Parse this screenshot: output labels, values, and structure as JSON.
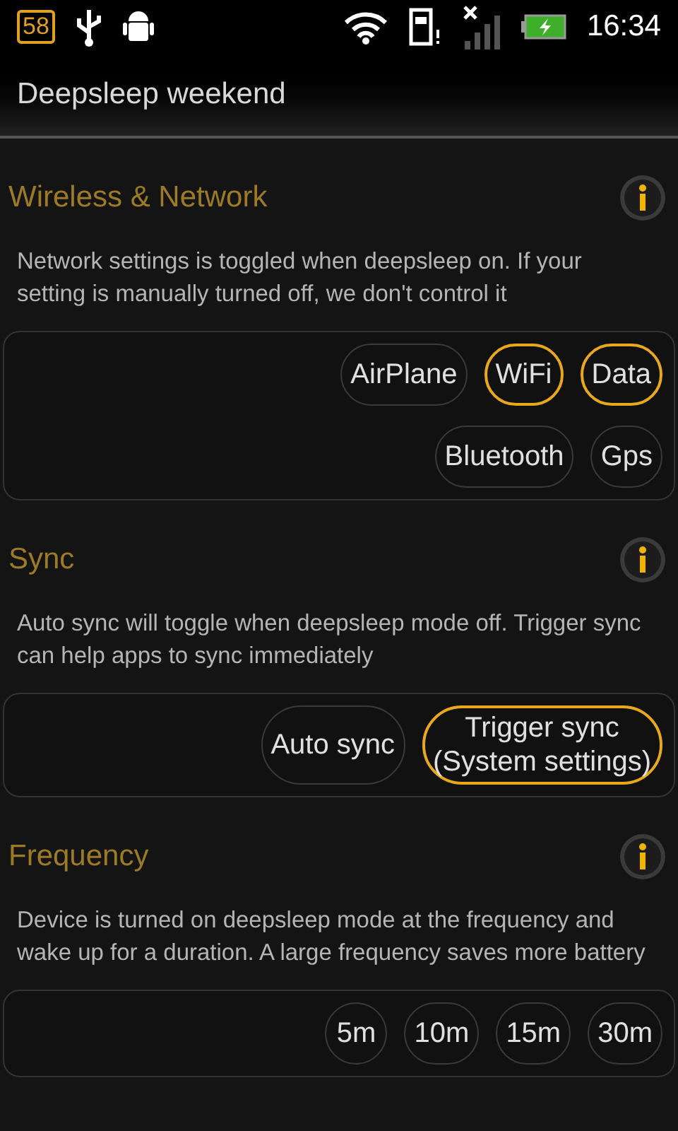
{
  "status_bar": {
    "notification_badge": "58",
    "time": "16:34"
  },
  "title": "Deepsleep weekend",
  "sections": [
    {
      "title": "Wireless & Network",
      "description": "Network settings is toggled when deepsleep on. If your setting is manually turned off, we don't control it",
      "options": [
        {
          "label": "AirPlane",
          "selected": false
        },
        {
          "label": "WiFi",
          "selected": true
        },
        {
          "label": "Data",
          "selected": true
        },
        {
          "label": "Bluetooth",
          "selected": false
        },
        {
          "label": "Gps",
          "selected": false
        }
      ]
    },
    {
      "title": "Sync",
      "description": "Auto sync will toggle when deepsleep mode off. Trigger sync can help apps to sync immediately",
      "options": [
        {
          "label": "Auto sync",
          "selected": false
        },
        {
          "label": "Trigger sync\n(System settings)",
          "selected": true
        }
      ]
    },
    {
      "title": "Frequency",
      "description": "Device is turned on deepsleep mode at the frequency and wake up for a duration. A large frequency saves more battery",
      "options": [
        {
          "label": "5m",
          "selected": false
        },
        {
          "label": "10m",
          "selected": false
        },
        {
          "label": "15m",
          "selected": false
        },
        {
          "label": "30m",
          "selected": false
        }
      ]
    }
  ]
}
